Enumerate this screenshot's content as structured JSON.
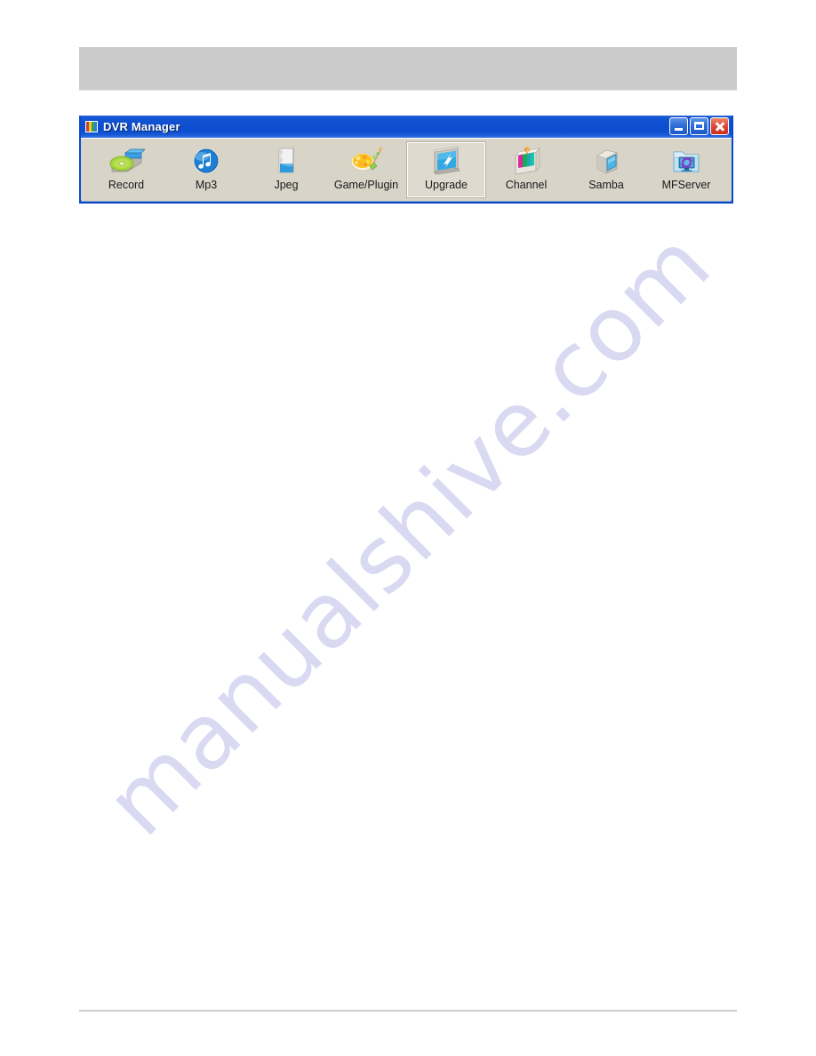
{
  "page": {
    "watermark": "manualshive.com",
    "watermark_color": "#d9d9f2",
    "header_band_color": "#cbcbcb",
    "footer_rule_color": "#cdcdcd"
  },
  "window": {
    "title": "DVR Manager",
    "title_bar_color": "#0c4ecf",
    "border_color": "#0a4ad1",
    "toolbar_color": "#d8d4c8",
    "controls": {
      "minimize_label": "Minimize",
      "maximize_label": "Maximize",
      "close_label": "Close"
    }
  },
  "toolbar": {
    "selected_index": 4,
    "buttons": [
      {
        "label": "Record",
        "icon": "cd-record-icon"
      },
      {
        "label": "Mp3",
        "icon": "music-note-icon"
      },
      {
        "label": "Jpeg",
        "icon": "image-file-icon"
      },
      {
        "label": "Game/Plugin",
        "icon": "palette-icon"
      },
      {
        "label": "Upgrade",
        "icon": "upgrade-screen-icon"
      },
      {
        "label": "Channel",
        "icon": "color-bars-monitor-icon"
      },
      {
        "label": "Samba",
        "icon": "server-box-icon"
      },
      {
        "label": "MFServer",
        "icon": "folder-sync-icon"
      }
    ]
  }
}
